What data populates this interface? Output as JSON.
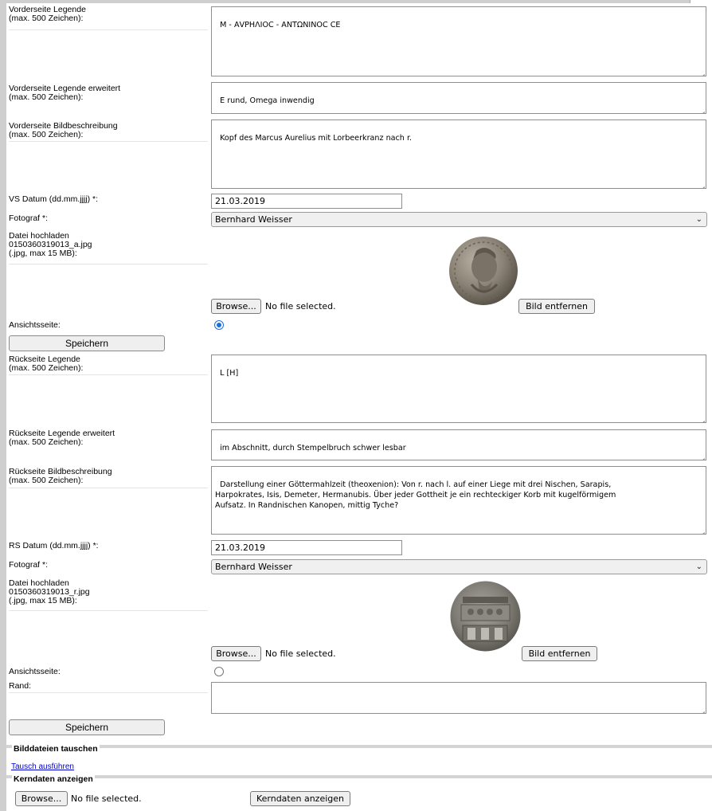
{
  "vorderseite": {
    "legende": {
      "label": "Vorderseite Legende",
      "hint": "(max. 500 Zeichen):",
      "value": "M - ΑVΡΗΛΙΟC - ΑΝΤΩΝΙΝΟC CE"
    },
    "legende_erweitert": {
      "label": "Vorderseite Legende erweitert",
      "hint": "(max. 500 Zeichen):",
      "value": "E rund, Omega inwendig"
    },
    "bildbeschreibung": {
      "label": "Vorderseite Bildbeschreibung",
      "hint": "(max. 500 Zeichen):",
      "value": "Kopf des Marcus Aurelius mit Lorbeerkranz nach r."
    },
    "datum": {
      "label": "VS Datum (dd.mm.jjjj) *:",
      "value": "21.03.2019"
    },
    "fotograf": {
      "label": "Fotograf *:",
      "value": "Bernhard Weisser"
    },
    "upload": {
      "label": "Datei hochladen",
      "filename": "0150360319013_a.jpg",
      "hint": "(.jpg, max 15 MB):",
      "browse": "Browse...",
      "status": "No file selected.",
      "remove": "Bild entfernen"
    },
    "ansicht": {
      "label": "Ansichtsseite:",
      "checked": true
    },
    "save": "Speichern"
  },
  "rueckseite": {
    "legende": {
      "label": "Rückseite Legende",
      "hint": "(max. 500 Zeichen):",
      "value": "L [H]"
    },
    "legende_erweitert": {
      "label": "Rückseite Legende erweitert",
      "hint": "(max. 500 Zeichen):",
      "value": "im Abschnitt, durch Stempelbruch schwer lesbar"
    },
    "bildbeschreibung": {
      "label": "Rückseite Bildbeschreibung",
      "hint": "(max. 500 Zeichen):",
      "value": "Darstellung einer Göttermahlzeit (theoxenion): Von r. nach l. auf einer Liege mit drei Nischen, Sarapis,\nHarpokrates, Isis, Demeter, Hermanubis. Über jeder Gottheit je ein rechteckiger Korb mit kugelförmigem\nAufsatz. In Randnischen Kanopen, mittig Tyche?"
    },
    "datum": {
      "label": "RS Datum (dd.mm.jjjj) *:",
      "value": "21.03.2019"
    },
    "fotograf": {
      "label": "Fotograf *:",
      "value": "Bernhard Weisser"
    },
    "upload": {
      "label": "Datei hochladen",
      "filename": "0150360319013_r.jpg",
      "hint": "(.jpg, max 15 MB):",
      "browse": "Browse...",
      "status": "No file selected.",
      "remove": "Bild entfernen"
    },
    "ansicht": {
      "label": "Ansichtsseite:",
      "checked": false
    },
    "rand": {
      "label": "Rand:",
      "value": ""
    },
    "save": "Speichern"
  },
  "bilddateien": {
    "legend": "Bilddateien tauschen",
    "link": "Tausch ausführen"
  },
  "kerndaten": {
    "legend": "Kerndaten anzeigen",
    "browse": "Browse...",
    "status": "No file selected.",
    "button": "Kerndaten anzeigen"
  },
  "colors": {
    "frame": "#cfcfcf",
    "link": "#0000cc",
    "radio_active": "#1a6fe0"
  }
}
